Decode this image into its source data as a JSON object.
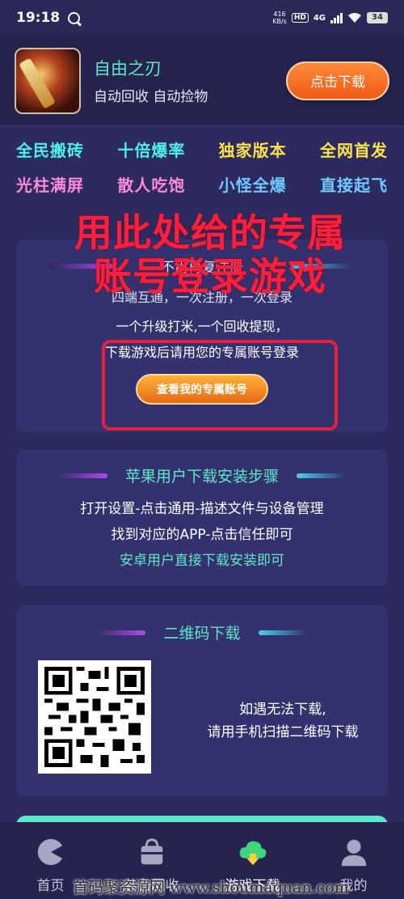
{
  "status_bar": {
    "time": "19:18",
    "net_speed_value": "416",
    "net_speed_unit": "KB/s",
    "hd_label": "HD",
    "network_type": "4G",
    "battery": "34"
  },
  "app_header": {
    "name": "自由之刃",
    "tags": "自动回收 自动捡物",
    "download_label": "点击下载"
  },
  "features": {
    "row1": [
      "全民搬砖",
      "十倍爆率",
      "独家版本",
      "全网首发"
    ],
    "row2": [
      "光柱满屏",
      "散人吃饱",
      "小怪全爆",
      "直接起飞"
    ]
  },
  "account": {
    "title": "不用再复注册",
    "subtitle": "四端互通，一次注册，一次登录",
    "line1": "一个升级打米,一个回收提现，",
    "line2": "下载游戏后请用您的专属账号登录",
    "button_label": "查看我的专属账号"
  },
  "overlay": {
    "line1": "用此处给的专属",
    "line2": "账号登录游戏"
  },
  "steps": {
    "title": "苹果用户下载安装步骤",
    "step1": "打开设置-点击通用-描述文件与设备管理",
    "step2": "找到对应的APP-点击信任即可",
    "step3": "安卓用户直接下载安装即可"
  },
  "qr": {
    "title": "二维码下载",
    "text1": "如遇无法下载,",
    "text2": "请用手机扫描二维码下载"
  },
  "nav": {
    "items": [
      {
        "label": "首页",
        "icon": "home-icon"
      },
      {
        "label": "装备回收",
        "icon": "bag-icon"
      },
      {
        "label": "游戏下载",
        "icon": "cloud-download-icon"
      },
      {
        "label": "我的",
        "icon": "user-icon"
      }
    ]
  },
  "watermark": "首码聚资源网 www.shoumaquan.com",
  "colors": {
    "background": "#2c2a5e",
    "accent_teal": "#5fe6c6",
    "accent_orange": "#f05a18",
    "overlay_red": "#ff1e3c"
  }
}
